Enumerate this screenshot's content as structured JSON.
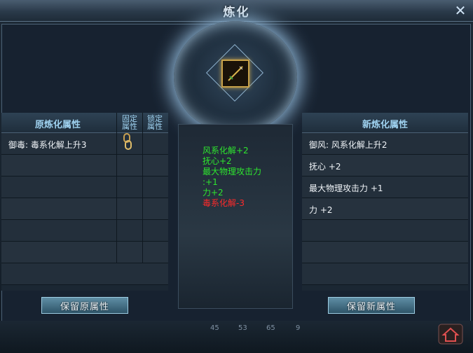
{
  "window": {
    "title": "炼化",
    "close_icon": "close-icon"
  },
  "left_panel": {
    "header": "原炼化属性",
    "col_fixed": "固定属性",
    "col_lock": "锁定属性",
    "rows": [
      {
        "text": "御毒: 毒系化解上升3",
        "has_chain": true
      },
      {
        "text": ""
      },
      {
        "text": ""
      },
      {
        "text": ""
      },
      {
        "text": ""
      },
      {
        "text": ""
      },
      {
        "text": ""
      }
    ]
  },
  "right_panel": {
    "header": "新炼化属性",
    "rows": [
      {
        "text": "御风: 风系化解上升2"
      },
      {
        "text": "抚心 +2"
      },
      {
        "text": "最大物理攻击力 +1"
      },
      {
        "text": "力 +2"
      },
      {
        "text": ""
      },
      {
        "text": ""
      },
      {
        "text": ""
      }
    ]
  },
  "comparison": {
    "lines": [
      {
        "text": "风系化解+2",
        "color": "#2ee62e"
      },
      {
        "text": "抚心+2",
        "color": "#2ee62e"
      },
      {
        "text": "最大物理攻击力",
        "color": "#2ee62e"
      },
      {
        "text": ":+1",
        "color": "#2ee62e"
      },
      {
        "text": "力+2",
        "color": "#2ee62e"
      },
      {
        "text": "毒系化解-3",
        "color": "#ff2a2a"
      }
    ]
  },
  "buttons": {
    "keep_original": "保留原属性",
    "keep_new": "保留新属性"
  },
  "dock": {
    "numbers": [
      "45",
      "53",
      "65",
      "9"
    ]
  },
  "colors": {
    "accent": "#9fd2f0",
    "gain": "#2ee62e",
    "loss": "#ff2a2a"
  }
}
